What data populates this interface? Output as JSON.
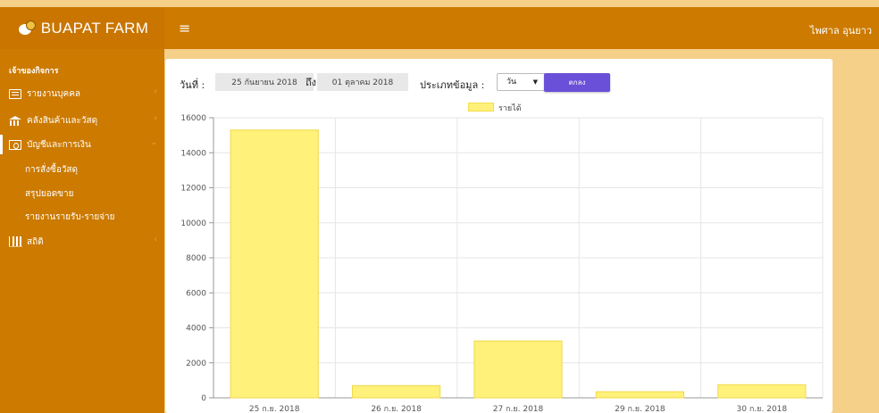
{
  "header": {
    "brand": "BUAPAT FARM",
    "menu_icon": "hamburger-icon",
    "username": "ไพศาล อุนยาว"
  },
  "sidebar": {
    "section_title": "เจ้าของกิจการ",
    "items": [
      {
        "label": "รายงานบุคคล",
        "icon": "report-icon"
      },
      {
        "label": "คลังสินค้าและวัสดุ",
        "icon": "bank-icon"
      },
      {
        "label": "บัญชีและการเงิน",
        "icon": "money-icon",
        "active": true
      },
      {
        "label": "สถิติ",
        "icon": "bar-chart-icon"
      }
    ],
    "subitems": [
      "การสั่งซื้อวัสดุ",
      "สรุปยอดขาย",
      "รายงานรายรับ-รายจ่าย"
    ]
  },
  "filter": {
    "date_label": "วันที่ :",
    "start_date": "25 กันยายน 2018",
    "to_label": "ถึง",
    "end_date": "01 ตุลาคม 2018",
    "type_label": "ประเภทข้อมูล :",
    "type_value": "วัน",
    "ok_label": "ตกลง"
  },
  "colors": {
    "header": "#cc7a00",
    "background": "#f5d089",
    "bar": "#fff17a",
    "button": "#6a4fd8"
  },
  "chart_data": {
    "type": "bar",
    "categories": [
      "25 ก.ย. 2018",
      "26 ก.ย. 2018",
      "27 ก.ย. 2018",
      "29 ก.ย. 2018",
      "30 ก.ย. 2018"
    ],
    "series": [
      {
        "name": "รายได้",
        "values": [
          15300,
          700,
          3250,
          350,
          750
        ]
      }
    ],
    "ylim": [
      0,
      16000
    ],
    "yticks": [
      0,
      2000,
      4000,
      6000,
      8000,
      10000,
      12000,
      14000,
      16000
    ],
    "grid": true,
    "legend": "top-center"
  }
}
